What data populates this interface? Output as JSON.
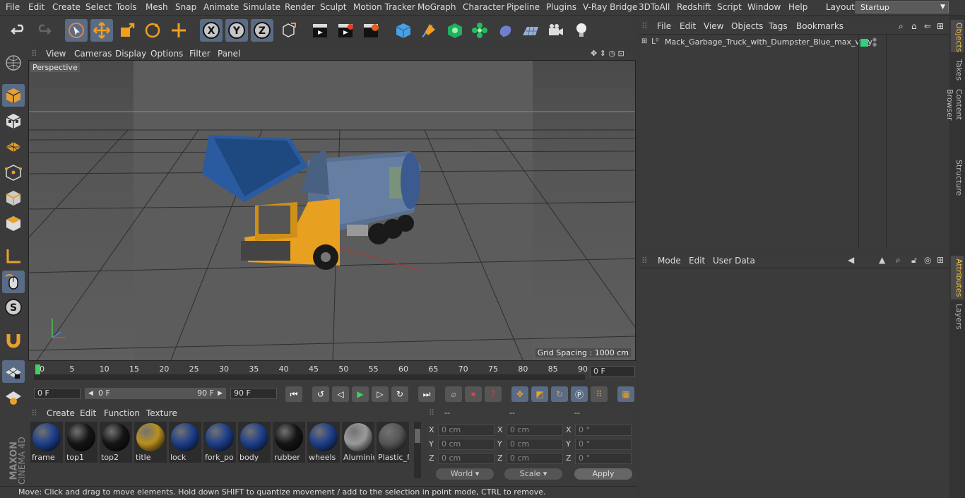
{
  "menubar": {
    "items": [
      "File",
      "Edit",
      "Create",
      "Select",
      "Tools",
      "Mesh",
      "Snap",
      "Animate",
      "Simulate",
      "Render",
      "Sculpt",
      "Motion Tracker",
      "MoGraph",
      "Character",
      "Pipeline",
      "Plugins",
      "V-Ray Bridge",
      "3DToAll",
      "Redshift",
      "Script",
      "Window",
      "Help"
    ],
    "layout_label": "Layout:",
    "layout_value": "Startup"
  },
  "viewport": {
    "menu": [
      "View",
      "Cameras",
      "Display",
      "Options",
      "Filter",
      "Panel"
    ],
    "label": "Perspective",
    "grid_spacing": "Grid Spacing : 1000 cm"
  },
  "timeline": {
    "ticks": [
      "0",
      "5",
      "10",
      "15",
      "20",
      "25",
      "30",
      "35",
      "40",
      "45",
      "50",
      "55",
      "60",
      "65",
      "70",
      "75",
      "80",
      "85",
      "90"
    ],
    "current_frame": "0 F",
    "start_field": "0 F",
    "range_start": "0 F",
    "range_end": "90 F",
    "end_field": "90 F"
  },
  "materials": {
    "menu": [
      "Create",
      "Edit",
      "Function",
      "Texture"
    ],
    "items": [
      {
        "name": "frame",
        "color": "#1e3f8a"
      },
      {
        "name": "top1",
        "color": "#151515"
      },
      {
        "name": "top2",
        "color": "#151515"
      },
      {
        "name": "title",
        "color": "#b89020"
      },
      {
        "name": "lock",
        "color": "#1e3f8a"
      },
      {
        "name": "fork_po",
        "color": "#1e3f8a"
      },
      {
        "name": "body",
        "color": "#1e3f8a"
      },
      {
        "name": "rubber",
        "color": "#151515"
      },
      {
        "name": "wheels",
        "color": "#1e3f8a"
      },
      {
        "name": "Aluminiu",
        "color": "#9a9a9a"
      },
      {
        "name": "Plastic_f",
        "color": "#555555"
      }
    ]
  },
  "coords": {
    "headers": [
      "--",
      "--",
      "--"
    ],
    "rows": [
      {
        "a": "X",
        "v1": "0 cm",
        "b": "X",
        "v2": "0 cm",
        "c": "X",
        "v3": "0 °"
      },
      {
        "a": "Y",
        "v1": "0 cm",
        "b": "Y",
        "v2": "0 cm",
        "c": "Y",
        "v3": "0 °"
      },
      {
        "a": "Z",
        "v1": "0 cm",
        "b": "Z",
        "v2": "0 cm",
        "c": "Z",
        "v3": "0 °"
      }
    ],
    "world": "World",
    "scale": "Scale",
    "apply": "Apply"
  },
  "object_manager": {
    "menu": [
      "File",
      "Edit",
      "View",
      "Objects",
      "Tags",
      "Bookmarks"
    ],
    "object_name": "Mack_Garbage_Truck_with_Dumpster_Blue_max_vray"
  },
  "attributes": {
    "menu": [
      "Mode",
      "Edit",
      "User Data"
    ]
  },
  "right_tabs": [
    "Objects",
    "Takes",
    "Content Browser",
    "Structure",
    "Attributes",
    "Layers"
  ],
  "status": "Move: Click and drag to move elements. Hold down SHIFT to quantize movement / add to the selection in point mode, CTRL to remove.",
  "logo": {
    "line1": "MAXON",
    "line2": "CINEMA 4D"
  },
  "colors": {
    "accent": "#5a6b85",
    "viewport": "#555555",
    "truck_cab": "#e8a020",
    "dumpster": "#2a5aa0"
  }
}
